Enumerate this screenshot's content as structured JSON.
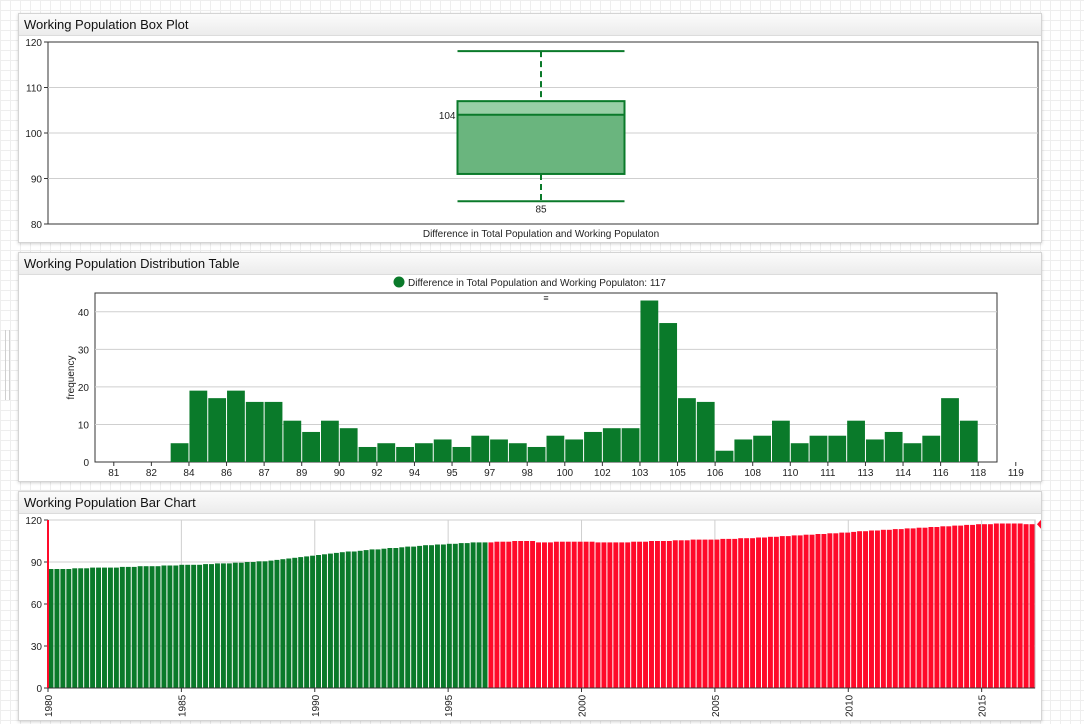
{
  "colors": {
    "green": "#0a7a2a",
    "red": "#ff0a2a",
    "grid": "#cfcfcf",
    "box_fill": "#6ab57e",
    "box_upper": "#98cfa6"
  },
  "box_widget": {
    "title": "Working Population Box Plot"
  },
  "hist_widget": {
    "title": "Working Population Distribution Table"
  },
  "bar_widget": {
    "title": "Working Population Bar Chart"
  },
  "chart_data": [
    {
      "type": "box",
      "xlabel": "Difference in Total Population and Working Populaton",
      "ylim": [
        80,
        120
      ],
      "yticks": [
        80,
        90,
        100,
        110,
        120
      ],
      "whisker_low": 85,
      "q1": 91,
      "median": 104,
      "q3": 107,
      "whisker_high": 118,
      "median_label": "104",
      "min_label": "85"
    },
    {
      "type": "bar",
      "legend": "Difference in Total Population and Working Populaton: 117",
      "menu_glyph": "≡",
      "ylabel": "frequency",
      "ylim": [
        0,
        45
      ],
      "yticks": [
        0,
        10,
        20,
        30,
        40
      ],
      "x_start": 80.5,
      "bin_width": 1,
      "x_range": [
        80.5,
        119.5
      ],
      "x_ticks": [
        {
          "x": 81,
          "label": "81"
        },
        {
          "x": 83,
          "label": "82"
        },
        {
          "x": 85,
          "label": "84"
        },
        {
          "x": 87,
          "label": "86"
        },
        {
          "x": 89,
          "label": "87"
        },
        {
          "x": 91,
          "label": "89"
        },
        {
          "x": 93,
          "label": "90"
        },
        {
          "x": 95,
          "label": "92"
        },
        {
          "x": 97,
          "label": "94"
        },
        {
          "x": 99,
          "label": "95"
        },
        {
          "x": 101,
          "label": "97"
        },
        {
          "x": 103,
          "label": "98"
        },
        {
          "x": 105,
          "label": "100"
        },
        {
          "x": 107,
          "label": "102"
        },
        {
          "x": 109,
          "label": "103"
        },
        {
          "x": 111,
          "label": "105"
        },
        {
          "x": 113,
          "label": "106"
        },
        {
          "x": 115,
          "label": "108"
        },
        {
          "x": 117,
          "label": "110"
        },
        {
          "x": 119,
          "label": "111"
        },
        {
          "x": 121,
          "label": "113"
        },
        {
          "x": 123,
          "label": "114"
        },
        {
          "x": 125,
          "label": "116"
        },
        {
          "x": 127,
          "label": "118"
        },
        {
          "x": 129,
          "label": "119"
        }
      ],
      "values": [
        0,
        0,
        0,
        0,
        5,
        19,
        17,
        19,
        16,
        16,
        11,
        8,
        11,
        9,
        4,
        5,
        4,
        5,
        6,
        4,
        7,
        6,
        5,
        4,
        7,
        6,
        8,
        9,
        9,
        43,
        37,
        17,
        16,
        3,
        6,
        7,
        11,
        5,
        7,
        7,
        11,
        6,
        8,
        5,
        7,
        17,
        11,
        0
      ]
    },
    {
      "type": "bar",
      "x_start": 1980,
      "x_end": 2017,
      "xticks": [
        1980,
        1985,
        1990,
        1995,
        2000,
        2005,
        2010,
        2015
      ],
      "ylim": [
        0,
        120
      ],
      "yticks": [
        0,
        30,
        60,
        90,
        120
      ],
      "threshold_index": 74,
      "last_value_label": "117",
      "values": [
        85,
        85,
        85,
        85,
        85.5,
        85.5,
        85.5,
        86,
        86,
        86,
        86,
        86,
        86.5,
        86.5,
        86.5,
        87,
        87,
        87,
        87,
        87.5,
        87.5,
        87.5,
        88,
        88,
        88,
        88,
        88.5,
        88.5,
        89,
        89,
        89,
        89.5,
        89.5,
        90,
        90,
        90.5,
        90.5,
        91,
        91.5,
        92,
        92.5,
        93,
        93.5,
        94,
        94.5,
        95,
        95.5,
        96,
        96.5,
        97,
        97.5,
        97.5,
        98,
        98.5,
        99,
        99,
        99.5,
        100,
        100,
        100.5,
        101,
        101,
        101.5,
        102,
        102,
        102.5,
        102.5,
        103,
        103,
        103.5,
        103.5,
        104,
        104,
        104,
        104,
        104.5,
        104.5,
        104.5,
        105,
        105,
        105,
        105,
        104,
        104,
        104,
        104.5,
        104.5,
        104.5,
        104.5,
        104.5,
        104.5,
        104.5,
        104,
        104,
        104,
        104,
        104,
        104,
        104.5,
        104.5,
        104.5,
        105,
        105,
        105,
        105,
        105.5,
        105.5,
        105.5,
        106,
        106,
        106,
        106,
        106,
        106.5,
        106.5,
        106.5,
        107,
        107,
        107,
        107.5,
        107.5,
        108,
        108,
        108.5,
        108.5,
        109,
        109,
        109.5,
        109.5,
        110,
        110,
        110.5,
        110.5,
        111,
        111,
        111.5,
        112,
        112,
        112.5,
        112.5,
        113,
        113,
        113.5,
        113.5,
        114,
        114,
        114.5,
        114.5,
        115,
        115,
        115.5,
        115.5,
        116,
        116,
        116.5,
        116.5,
        117,
        117,
        117,
        117.5,
        117.5,
        117.5,
        117.5,
        117.5,
        117,
        117
      ]
    }
  ]
}
